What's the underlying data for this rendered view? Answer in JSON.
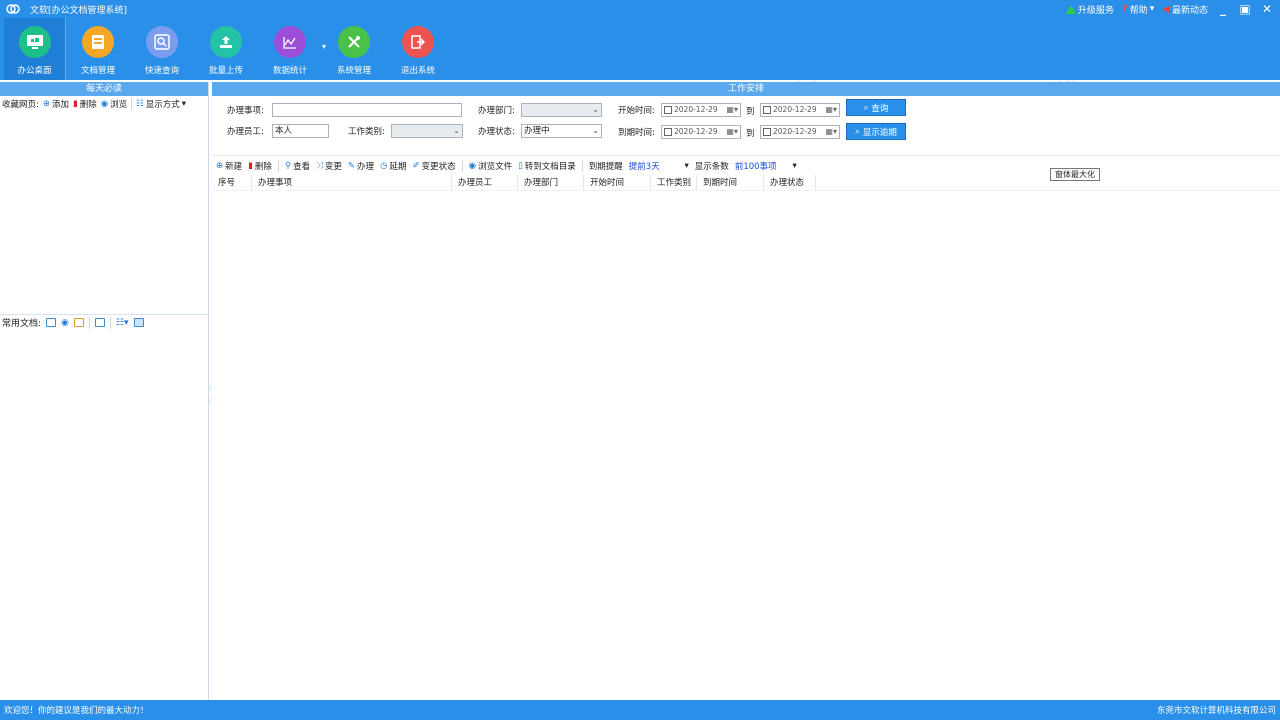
{
  "titlebar": {
    "title": "文软[办公文档管理系统]",
    "upgrade": "升级服务",
    "help": "帮助",
    "news": "最新动态"
  },
  "toolbar": {
    "items": [
      {
        "label": "办公桌面",
        "icon": "desktop-icon",
        "color": "#1fbf8a"
      },
      {
        "label": "文档管理",
        "icon": "document-icon",
        "color": "#f5a623"
      },
      {
        "label": "快速查询",
        "icon": "search-icon",
        "color": "#7b9df0"
      },
      {
        "label": "批量上传",
        "icon": "upload-icon",
        "color": "#22c3a6"
      },
      {
        "label": "数据统计",
        "icon": "chart-icon",
        "color": "#9b4fd8"
      },
      {
        "label": "系统管理",
        "icon": "tools-icon",
        "color": "#4ac24a"
      },
      {
        "label": "退出系统",
        "icon": "exit-icon",
        "color": "#ef5350"
      }
    ]
  },
  "left": {
    "header": "每天必读",
    "fav_label": "收藏网页:",
    "add": "添加",
    "delete": "删除",
    "browse": "浏览",
    "display": "显示方式",
    "docs_label": "常用文档:"
  },
  "right": {
    "header": "工作安排",
    "form": {
      "item_label": "办理事项:",
      "item_value": "",
      "staff_label": "办理员工:",
      "staff_value": "本人",
      "type_label": "工作类别:",
      "type_value": "",
      "dept_label": "办理部门:",
      "dept_value": "",
      "status_label": "办理状态:",
      "status_value": "办理中",
      "start_label": "开始时间:",
      "due_label": "到期时间:",
      "to": "到",
      "date1": "2020-12-29",
      "date2": "2020-12-29",
      "date3": "2020-12-29",
      "date4": "2020-12-29",
      "query": "查询",
      "overdue": "显示逾期"
    },
    "actions": {
      "new": "新建",
      "delete": "删除",
      "view": "查看",
      "change": "变更",
      "handle": "办理",
      "extend": "延期",
      "change_status": "变更状态",
      "browse_file": "浏览文件",
      "goto_dir": "转到文档目录",
      "remind_label": "到期提醒",
      "remind_value": "提前3天",
      "count_label": "显示条数",
      "count_value": "前100事项"
    },
    "columns": [
      "序号",
      "办理事项",
      "办理员工",
      "办理部门",
      "开始时间",
      "工作类别",
      "到期时间",
      "办理状态"
    ],
    "tooltip": "窗体最大化"
  },
  "status": {
    "left": "欢迎您！你的建议是我们的最大动力！",
    "right": "东莞市文软计算机科技有限公司"
  }
}
